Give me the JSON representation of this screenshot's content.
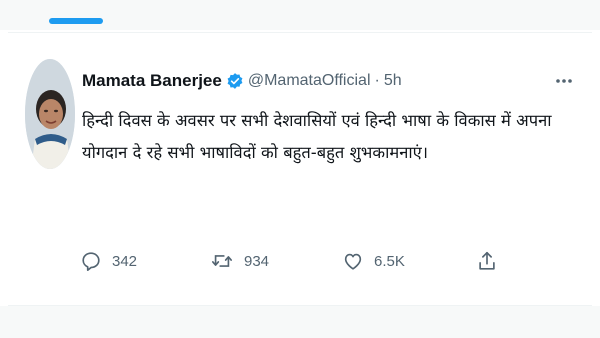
{
  "tweet": {
    "author_name": "Mamata Banerjee",
    "handle": "@MamataOfficial",
    "separator": "·",
    "time": "5h",
    "text": "हिन्दी दिवस के अवसर पर सभी देशवासियों एवं हिन्दी भाषा के विकास में अपना योगदान दे रहे सभी भाषाविदों को बहुत-बहुत शुभकामनाएं।",
    "verified": true,
    "accent_color": "#1d9bf0"
  },
  "actions": {
    "reply_count": "342",
    "retweet_count": "934",
    "like_count": "6.5K"
  },
  "icons": {
    "verified": "verified-badge-icon",
    "more": "more-options-icon",
    "reply": "reply-icon",
    "retweet": "retweet-icon",
    "like": "heart-icon",
    "share": "share-icon"
  }
}
